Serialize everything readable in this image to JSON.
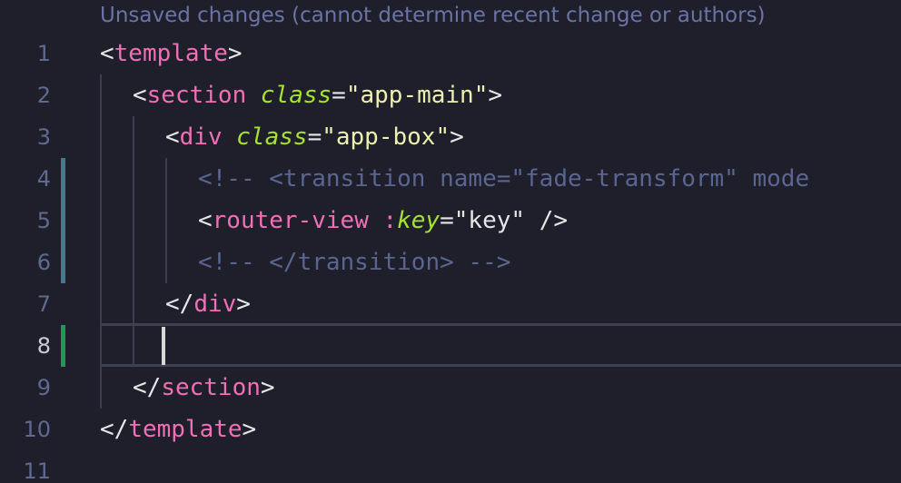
{
  "editor": {
    "codelens": "Unsaved changes (cannot determine recent change or authors)",
    "colors": {
      "background": "#1e1f2b",
      "tag": "#f06fb6",
      "attribute": "#a6e22e",
      "string": "#eef0b0",
      "comment": "#5a6590",
      "line_number": "#5f6a8f",
      "gutter_modified": "#3b7f8c",
      "gutter_added": "#1f9a55"
    },
    "cursor_line": 8,
    "lines": [
      {
        "number": "1",
        "gutter": "none"
      },
      {
        "number": "2",
        "gutter": "none"
      },
      {
        "number": "3",
        "gutter": "none"
      },
      {
        "number": "4",
        "gutter": "modified"
      },
      {
        "number": "5",
        "gutter": "modified"
      },
      {
        "number": "6",
        "gutter": "modified"
      },
      {
        "number": "7",
        "gutter": "none"
      },
      {
        "number": "8",
        "gutter": "added"
      },
      {
        "number": "9",
        "gutter": "none"
      },
      {
        "number": "10",
        "gutter": "none"
      },
      {
        "number": "11",
        "gutter": "none"
      }
    ],
    "code": {
      "l1": {
        "open": "<",
        "tag": "template",
        "close": ">"
      },
      "l2": {
        "open": "<",
        "tag": "section",
        "attr": "class",
        "eq": "=",
        "value": "\"app-main\"",
        "close": ">"
      },
      "l3": {
        "open": "<",
        "tag": "div",
        "attr": "class",
        "eq": "=",
        "value": "\"app-box\"",
        "close": ">"
      },
      "l4": {
        "comment": "<!-- <transition name=\"fade-transform\" mode"
      },
      "l5": {
        "open": "<",
        "tag": "router-view",
        "space": " ",
        "prefix": ":",
        "attr": "key",
        "eq": "=",
        "value": "\"key\"",
        "close": " />"
      },
      "l6": {
        "comment": "<!-- </transition> -->"
      },
      "l7": {
        "open": "</",
        "tag": "div",
        "close": ">"
      },
      "l9": {
        "open": "</",
        "tag": "section",
        "close": ">"
      },
      "l10": {
        "open": "</",
        "tag": "template",
        "close": ">"
      }
    }
  }
}
